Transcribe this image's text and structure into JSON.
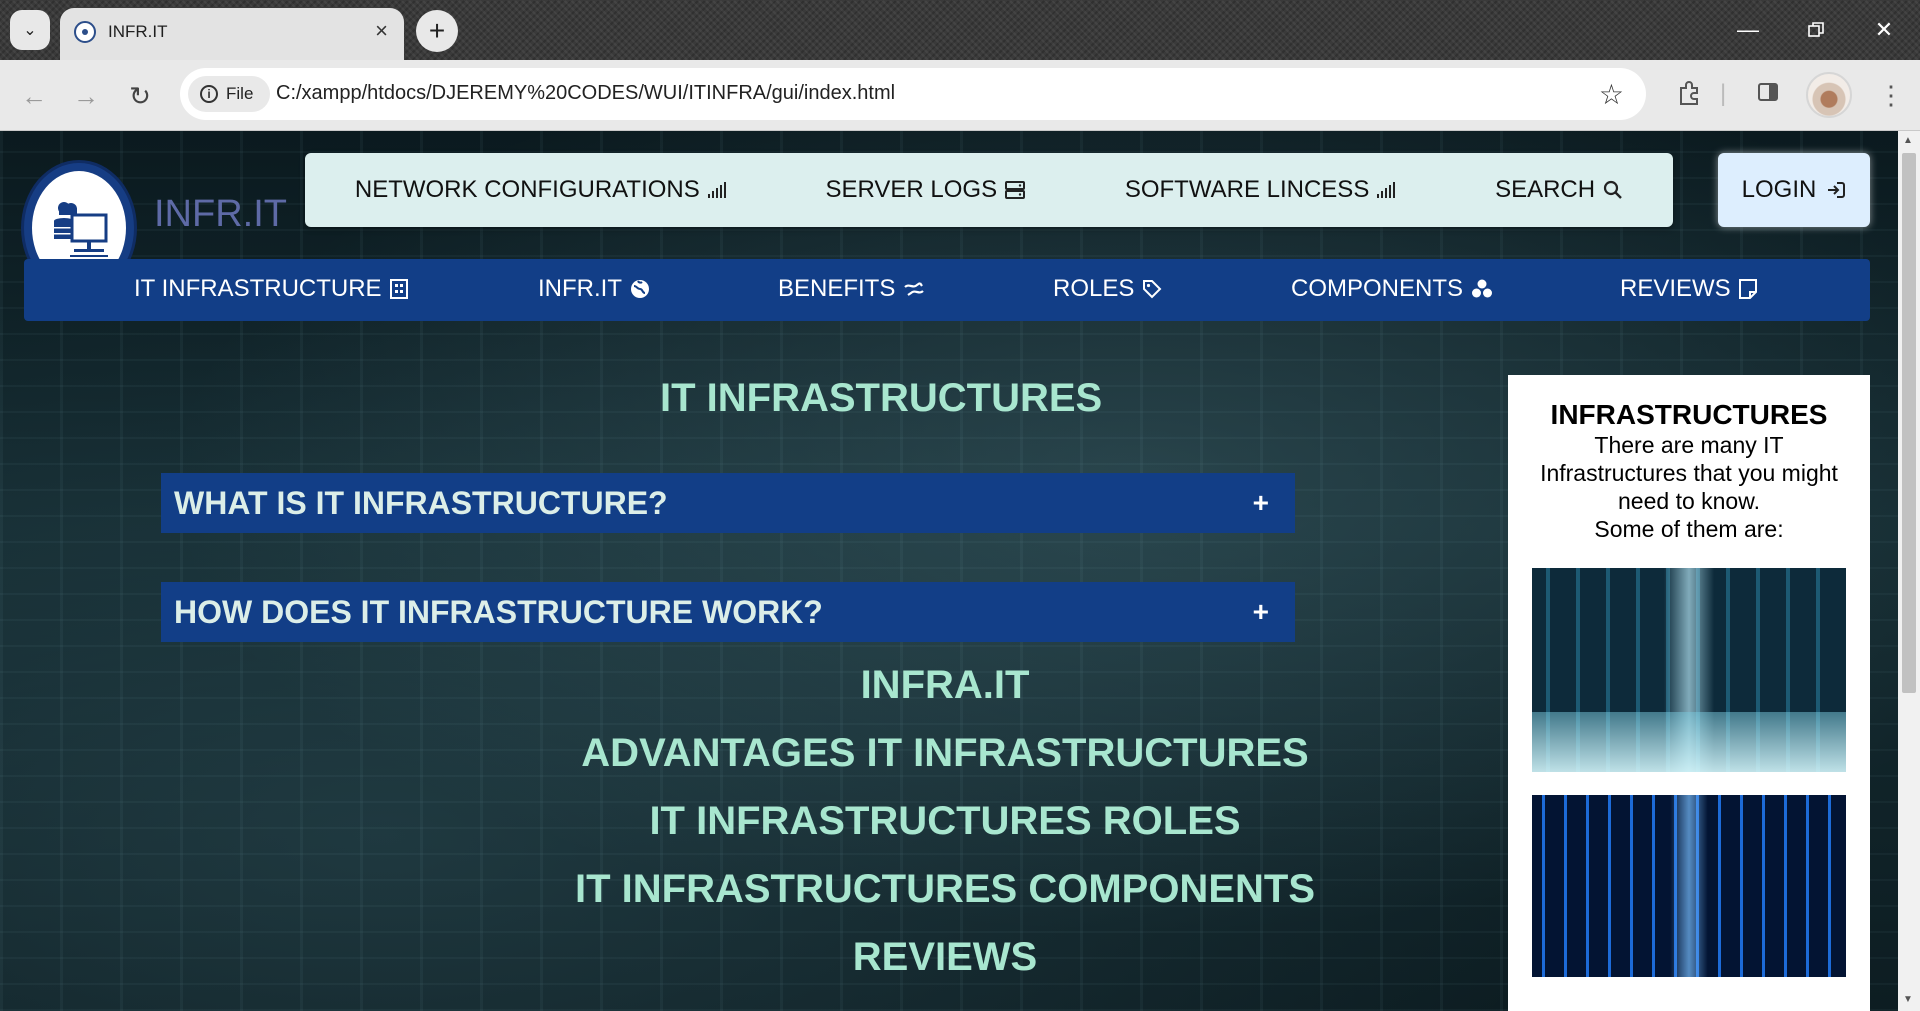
{
  "browser": {
    "tab_title": "INFR.IT",
    "file_chip": "File",
    "url": "C:/xampp/htdocs/DJEREMY%20CODES/WUI/ITINFRA/gui/index.html"
  },
  "header": {
    "brand": "INFR.IT",
    "top_nav": [
      {
        "label": "NETWORK CONFIGURATIONS",
        "icon": "signal-bars-icon"
      },
      {
        "label": "SERVER LOGS",
        "icon": "server-icon"
      },
      {
        "label": "SOFTWARE LINCESS",
        "icon": "signal-bars-icon"
      },
      {
        "label": "SEARCH",
        "icon": "search-icon"
      }
    ],
    "login": {
      "label": "LOGIN",
      "icon": "sign-in-icon"
    }
  },
  "main_nav": [
    {
      "label": "IT INFRASTRUCTURE",
      "icon": "building-icon"
    },
    {
      "label": "INFR.IT",
      "icon": "globe-icon"
    },
    {
      "label": "BENEFITS",
      "icon": "exchange-icon"
    },
    {
      "label": "ROLES",
      "icon": "tag-icon"
    },
    {
      "label": "COMPONENTS",
      "icon": "cubes-icon"
    },
    {
      "label": "REVIEWS",
      "icon": "note-icon"
    }
  ],
  "content": {
    "heading": "IT INFRASTRUCTURES",
    "accordions": [
      {
        "label": "WHAT IS IT INFRASTRUCTURE?",
        "toggle": "+"
      },
      {
        "label": "HOW DOES IT INFRASTRUCTURE WORK?",
        "toggle": "+"
      }
    ],
    "section_links": [
      "INFRA.IT",
      "ADVANTAGES IT INFRASTRUCTURES",
      "IT INFRASTRUCTURES ROLES",
      "IT INFRASTRUCTURES COMPONENTS",
      "REVIEWS"
    ]
  },
  "sidebar": {
    "title": "INFRASTRUCTURES",
    "text_lines": [
      "There are many IT",
      "Infrastructures that you might",
      "need to know.",
      "Some of them are:"
    ]
  },
  "colors": {
    "nav_blue": "#123e87",
    "heading_mint": "#a8e6cf",
    "topnav_bg": "#dcefee",
    "login_bg": "#ddeefe"
  }
}
